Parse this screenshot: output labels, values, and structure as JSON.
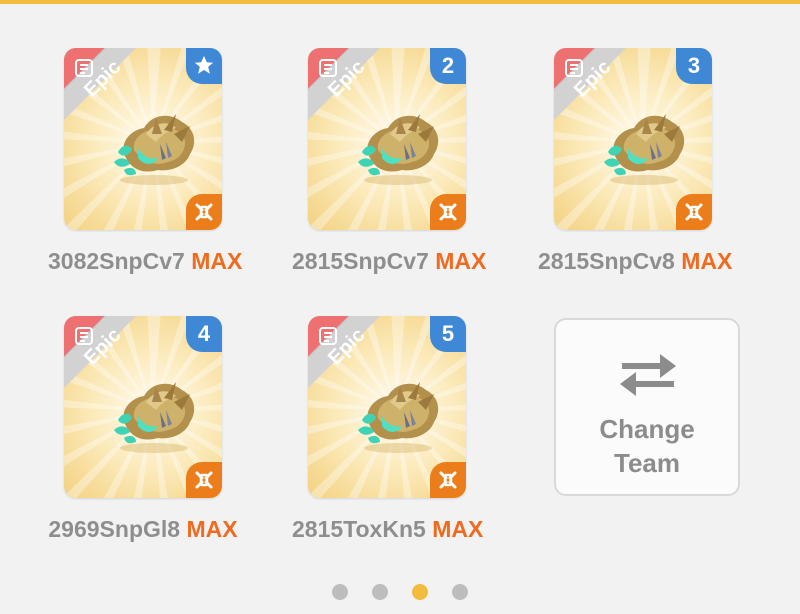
{
  "colors": {
    "accent": "#f0bd3c",
    "rarity_epic": "#ef7070",
    "slot_badge": "#3f88d6",
    "element_badge": "#ec7d1b",
    "max_text": "#ef6b1f",
    "name_text": "#8e8e8e"
  },
  "team": [
    {
      "slot": "",
      "slot_icon": "star-icon",
      "rarity": "Epic",
      "element_icon": "fossil-element-icon",
      "name": "3082SnpCv7",
      "level_tag": "MAX"
    },
    {
      "slot": "2",
      "slot_icon": "",
      "rarity": "Epic",
      "element_icon": "fossil-element-icon",
      "name": "2815SnpCv7",
      "level_tag": "MAX"
    },
    {
      "slot": "3",
      "slot_icon": "",
      "rarity": "Epic",
      "element_icon": "fossil-element-icon",
      "name": "2815SnpCv8",
      "level_tag": "MAX"
    },
    {
      "slot": "4",
      "slot_icon": "",
      "rarity": "Epic",
      "element_icon": "fossil-element-icon",
      "name": "2969SnpGl8",
      "level_tag": "MAX"
    },
    {
      "slot": "5",
      "slot_icon": "",
      "rarity": "Epic",
      "element_icon": "fossil-element-icon",
      "name": "2815ToxKn5",
      "level_tag": "MAX"
    }
  ],
  "change_team": {
    "line1": "Change",
    "line2": "Team",
    "icon": "swap-arrows-icon"
  },
  "pagination": {
    "total": 4,
    "current": 3
  }
}
